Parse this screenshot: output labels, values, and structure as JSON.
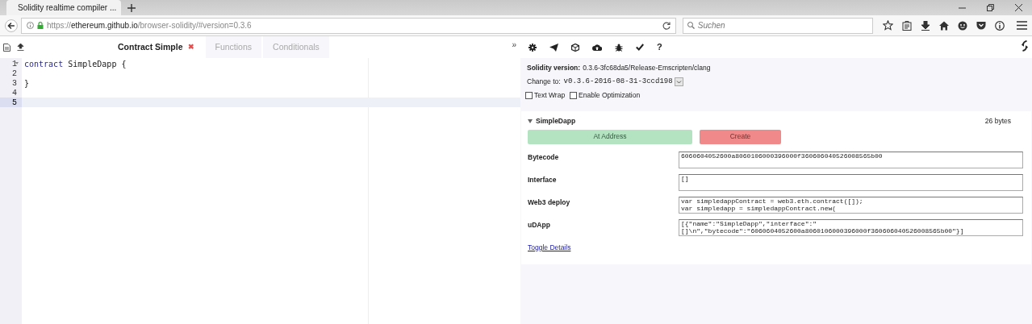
{
  "browser": {
    "tab_title": "Solidity realtime compiler ...",
    "url": {
      "scheme": "https://",
      "host": "ethereum.github.io",
      "path": "/browser-solidity/#version=0.3.6"
    },
    "search_placeholder": "Suchen"
  },
  "editor": {
    "file_tabs": [
      {
        "label": "Contract Simple",
        "selected": true
      },
      {
        "label": "Functions",
        "selected": false
      },
      {
        "label": "Conditionals",
        "selected": false
      }
    ],
    "close_glyph": "✖",
    "collapse_glyph": "»",
    "code_lines": [
      {
        "number": "1",
        "foldable": true,
        "active": false,
        "tokens": [
          {
            "text": "contract",
            "kind": "keyword"
          },
          {
            "text": " SimpleDapp {",
            "kind": "plain"
          }
        ]
      },
      {
        "number": "2",
        "foldable": false,
        "active": false
      },
      {
        "number": "3",
        "foldable": false,
        "active": false,
        "tokens": [
          {
            "text": "}",
            "kind": "plain"
          }
        ]
      },
      {
        "number": "4",
        "foldable": false,
        "active": false
      },
      {
        "number": "5",
        "foldable": false,
        "active": true
      }
    ]
  },
  "compiler": {
    "help_glyph": "?",
    "version_label": "Solidity version:",
    "version_value": "0.3.6-3fc68da5/Release-Emscripten/clang",
    "change_to_label": "Change to:",
    "change_to_value": "v0.3.6-2016-08-31-3ccd198",
    "options": [
      {
        "label": "Text Wrap",
        "checked": false
      },
      {
        "label": "Enable Optimization",
        "checked": false
      }
    ],
    "contract": {
      "name": "SimpleDapp",
      "expanded": true,
      "size": "26 bytes",
      "buttons": [
        {
          "label": "At Address",
          "kind": "at_address"
        },
        {
          "label": "Create",
          "kind": "create"
        }
      ],
      "fields": [
        {
          "label": "Bytecode",
          "lines": [
            "6060604052600a8060106000396000f360606040526008565b00"
          ]
        },
        {
          "label": "Interface",
          "lines": [
            "[]"
          ]
        },
        {
          "label": "Web3 deploy",
          "lines": [
            "var simpledappContract = web3.eth.contract([]);",
            "var simpledapp = simpledappContract.new("
          ]
        },
        {
          "label": "uDApp",
          "lines": [
            "[{\"name\":\"SimpleDapp\",\"interface\":\"",
            "[]\\n\",\"bytecode\":\"6060604052600a8060106000396000f360606040526008565b00\"}]"
          ]
        }
      ],
      "toggle_link": "Toggle Details"
    }
  }
}
